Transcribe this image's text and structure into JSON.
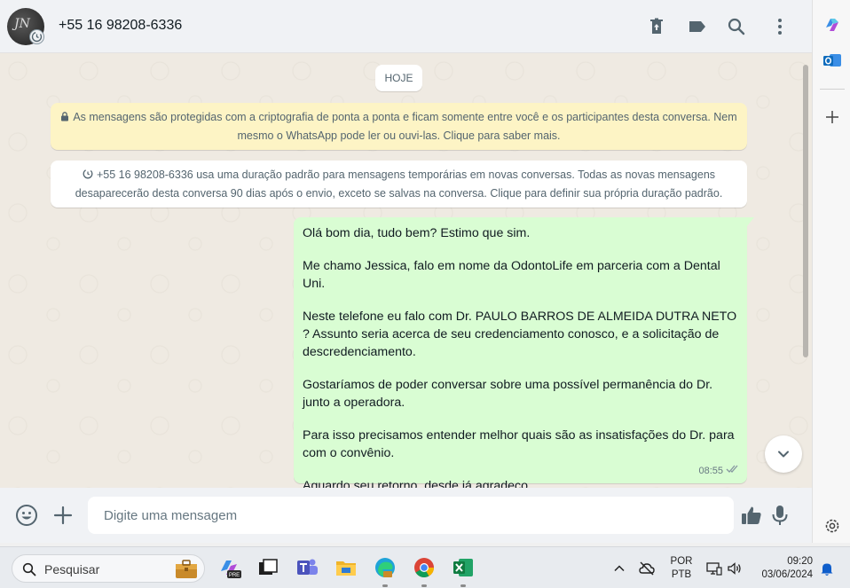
{
  "header": {
    "avatar_text": "JN",
    "contact_name": "+55 16 98208-6336",
    "icons": [
      "delete-icon",
      "label-icon",
      "search-icon",
      "menu-icon"
    ]
  },
  "chat": {
    "date_chip": "HOJE",
    "encryption_notice": "As mensagens são protegidas com a criptografia de ponta a ponta e ficam somente entre você e os participantes desta conversa. Nem mesmo o WhatsApp pode ler ou ouvi-las. Clique para saber mais.",
    "temporary_notice": "+55 16 98208-6336 usa uma duração padrão para mensagens temporárias em novas conversas. Todas as novas mensagens desaparecerão desta conversa 90 dias após o envio, exceto se salvas na conversa. Clique para definir sua própria duração padrão.",
    "message": {
      "paragraphs": [
        "Olá bom dia, tudo bem? Estimo que sim.",
        "Me chamo Jessica, falo em nome da OdontoLife em parceria com a Dental Uni.",
        "Neste telefone eu falo com Dr. PAULO BARROS DE ALMEIDA DUTRA NETO ? Assunto seria acerca de seu credenciamento conosco, e a solicitação de descredenciamento.",
        "Gostaríamos de poder conversar sobre uma possível permanência do Dr. junto a operadora.",
        "Para isso precisamos entender melhor quais são as insatisfações do Dr. para com o convênio.",
        "Aguardo seu retorno, desde já agradeço."
      ],
      "time": "08:55",
      "status": "read"
    }
  },
  "composer": {
    "placeholder": "Digite uma mensagem"
  },
  "taskbar": {
    "search_label": "Pesquisar",
    "lang_line1": "POR",
    "lang_line2": "PTB",
    "time": "09:20",
    "date": "03/06/2024"
  },
  "colors": {
    "bubble_out": "#d9fdd3",
    "enc_notice_bg": "#fdf4c5",
    "chat_bg": "#efeae2",
    "icon_gray": "#54656f"
  }
}
